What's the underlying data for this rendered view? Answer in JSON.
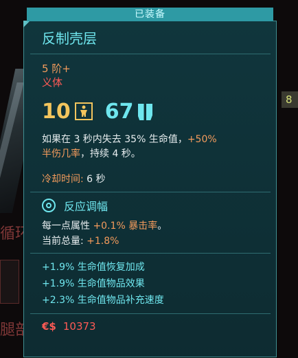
{
  "background": {
    "text_1": "循环",
    "text_2": "腿部",
    "tag": "8"
  },
  "header": {
    "equipped_label": "已装备"
  },
  "item": {
    "name": "反制壳层",
    "tier": "5 阶+",
    "type": "义体",
    "requirement": "10",
    "capacity": "67",
    "description": {
      "part1": "如果在 3 秒内失去 35% 生命值，",
      "part2_highlight": "+50%",
      "part3_highlight": "半伤几率",
      "part4": "，持续 4 秒。"
    },
    "cooldown": {
      "label": "冷却时间:",
      "value": "6 秒"
    }
  },
  "mod": {
    "name": "反应调幅",
    "line1_prefix": "每一点属性 ",
    "line1_value": "+0.1% 暴击率",
    "line1_suffix": "。",
    "line2_prefix": "当前总量: ",
    "line2_value": "+1.8%"
  },
  "bonuses": [
    "+1.9% 生命值恢复加成",
    "+1.9% 生命值物品效果",
    "+2.3% 生命值物品补充速度"
  ],
  "price": {
    "currency": "€$",
    "value": "10373"
  },
  "colors": {
    "accent_cyan": "#6fe6ee",
    "accent_orange": "#f39b5c",
    "accent_red": "#ff5a55",
    "accent_yellow": "#f3c55d"
  },
  "icons": {
    "requirement": "body-attribute-icon",
    "capacity": "cyberware-capacity-icon",
    "mod": "mod-ring-icon"
  }
}
